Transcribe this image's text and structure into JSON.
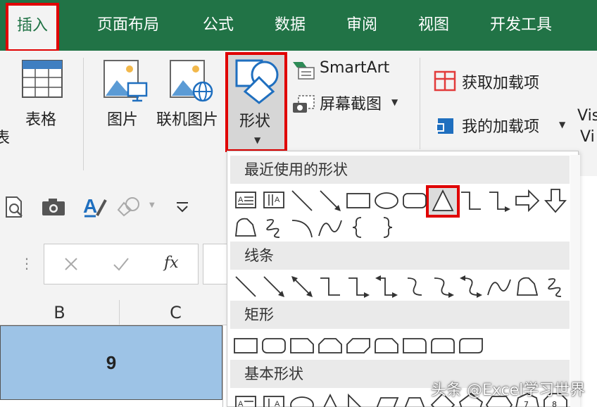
{
  "ribbon_tabs": {
    "insert": "插入",
    "page_layout": "页面布局",
    "formulas": "公式",
    "data": "数据",
    "review": "审阅",
    "view": "视图",
    "developer": "开发工具"
  },
  "ribbon": {
    "cut_char": "表",
    "table": "表格",
    "pictures": "图片",
    "online_pictures": "联机图片",
    "shapes": "形状",
    "smartart": "SmartArt",
    "screenshot": "屏幕截图",
    "get_addins": "获取加载项",
    "my_addins": "我的加载项",
    "visio_line1": "Vis",
    "visio_line2": "Vi"
  },
  "formula_bar": {
    "fx_label": "fx"
  },
  "grid": {
    "col_b": "B",
    "col_c": "C",
    "cell_b_value": "9"
  },
  "shapes_menu": {
    "recent": "最近使用的形状",
    "lines": "线条",
    "rectangles": "矩形",
    "basic": "基本形状",
    "basic_item_7": "7",
    "basic_item_8": "8"
  },
  "watermark": "头条 @Excel学习世界",
  "colors": {
    "ribbon_green": "#217346",
    "highlight_red": "#e00000",
    "selected_cell": "#9dc3e6"
  }
}
